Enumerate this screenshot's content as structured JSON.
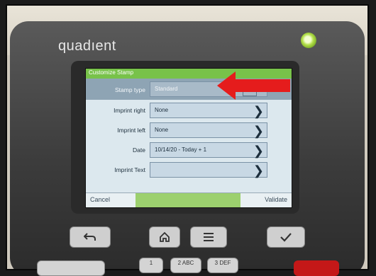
{
  "device": {
    "brand": "quadıent"
  },
  "screen": {
    "title": "Customize Stamp",
    "rows": [
      {
        "label": "Stamp type",
        "value": "Standard"
      },
      {
        "label": "Imprint right",
        "value": "None"
      },
      {
        "label": "Imprint left",
        "value": "None"
      },
      {
        "label": "Date",
        "value": "10/14/20 - Today + 1"
      },
      {
        "label": "Imprint Text",
        "value": ""
      }
    ],
    "cancel_label": "Cancel",
    "validate_label": "Validate"
  },
  "keypad": {
    "key1": "1",
    "key2": "2 ABC",
    "key3": "3 DEF"
  },
  "colors": {
    "accent_green": "#78c24a",
    "annotation_red": "#e51c1c"
  },
  "icons": [
    "back-icon",
    "home-icon",
    "menu-icon",
    "check-icon",
    "chevron-right-icon",
    "arrow-annotation"
  ]
}
